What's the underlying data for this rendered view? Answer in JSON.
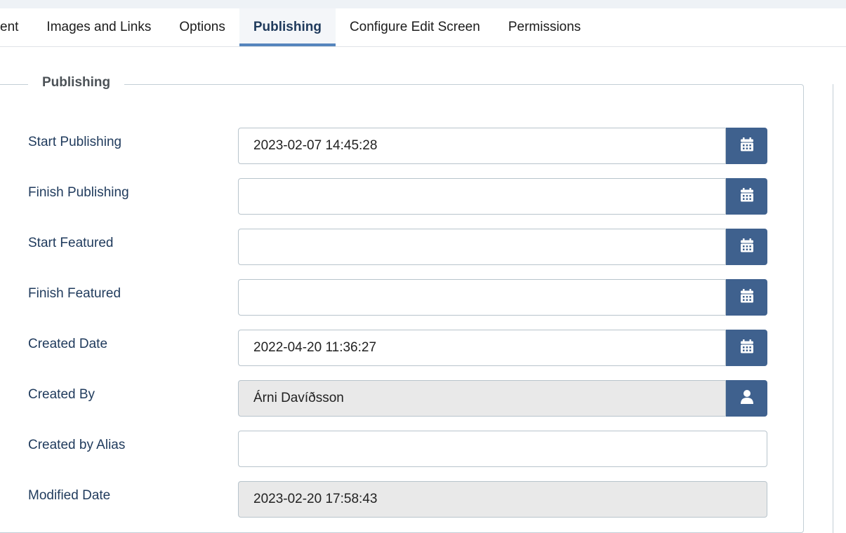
{
  "tabs": [
    "ent",
    "Images and Links",
    "Options",
    "Publishing",
    "Configure Edit Screen",
    "Permissions"
  ],
  "active_tab": "Publishing",
  "fieldset": {
    "legend": "Publishing"
  },
  "fields": [
    {
      "label": "Start Publishing",
      "value": "2023-02-07 14:45:28",
      "button": "calendar-icon"
    },
    {
      "label": "Finish Publishing",
      "value": "",
      "button": "calendar-icon"
    },
    {
      "label": "Start Featured",
      "value": "",
      "button": "calendar-icon"
    },
    {
      "label": "Finish Featured",
      "value": "",
      "button": "calendar-icon"
    },
    {
      "label": "Created Date",
      "value": "2022-04-20 11:36:27",
      "button": "calendar-icon"
    },
    {
      "label": "Created By",
      "value": "Árni Davíðsson",
      "button": "user-icon"
    },
    {
      "label": "Created by Alias",
      "value": ""
    },
    {
      "label": "Modified Date",
      "value": "2023-02-20 17:58:43"
    }
  ],
  "colors": {
    "button": "#3f618e",
    "tab_underline": "#5585bd",
    "label": "#1f3a5c"
  }
}
